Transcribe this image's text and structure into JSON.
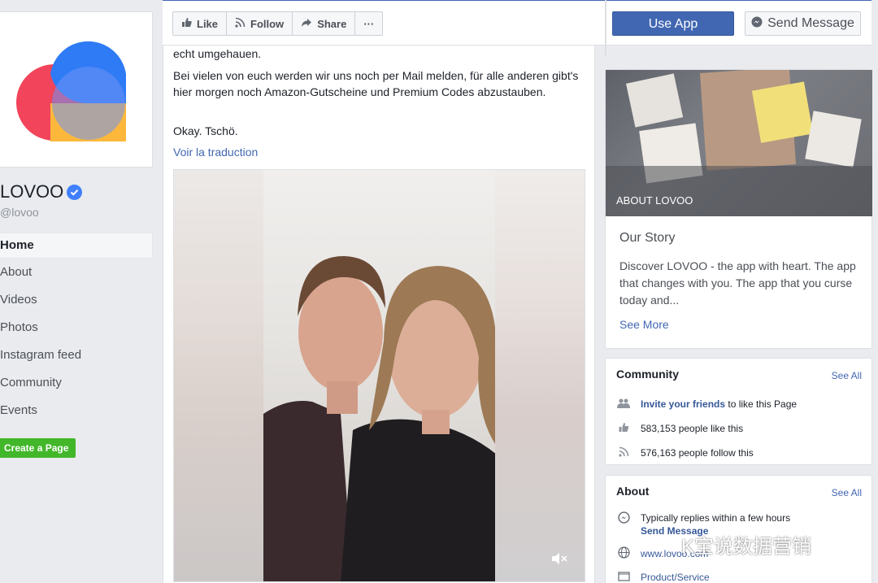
{
  "page": {
    "name": "LOVOO",
    "handle": "@lovoo"
  },
  "nav": {
    "items": [
      "Home",
      "About",
      "Videos",
      "Photos",
      "Instagram feed",
      "Community",
      "Events"
    ],
    "create_page": "Create a Page"
  },
  "toolbar": {
    "like": "Like",
    "follow": "Follow",
    "share": "Share",
    "more": "···",
    "use_app": "Use App",
    "send_message": "Send Message"
  },
  "post": {
    "line1": "echt umgehauen.",
    "line2": "Bei vielen von euch werden wir uns noch per Mail melden, für alle anderen gibt's hier morgen noch Amazon-Gutscheine und Premium Codes abzustauben.",
    "line3": "Okay. Tschö.",
    "translate": "Voir la traduction"
  },
  "about_lovoo": {
    "hero_label": "ABOUT LOVOO",
    "title": "Our Story",
    "text": "Discover LOVOO - the app with heart. The app that changes with you. The app that you curse today and...",
    "see_more": "See More"
  },
  "community": {
    "title": "Community",
    "see_all": "See All",
    "invite_link": "Invite your friends",
    "invite_rest": " to like this Page",
    "likes": "583,153 people like this",
    "follows": "576,163 people follow this"
  },
  "about": {
    "title": "About",
    "see_all": "See All",
    "replies": "Typically replies within a few hours",
    "send_message": "Send Message",
    "website": "www.lovoo.com",
    "category": "Product/Service"
  },
  "watermark": "K宝说数据营销",
  "colors": {
    "brand_blue": "#4267b2",
    "create_green": "#42b72a",
    "logo_red": "#f2445a",
    "logo_blue": "#2f7bf5",
    "logo_yellow": "#fdb83c"
  }
}
